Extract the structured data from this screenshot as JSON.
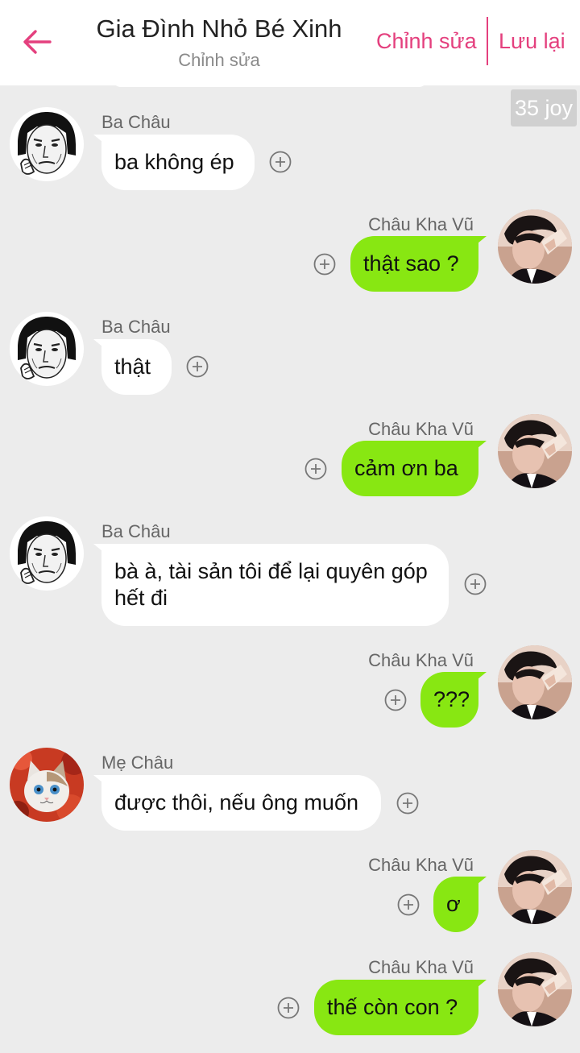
{
  "header": {
    "title": "Gia Đình Nhỏ Bé Xinh",
    "subtitle": "Chỉnh sửa",
    "edit_label": "Chỉnh sửa",
    "save_label": "Lưu lại"
  },
  "badge": "35 joy",
  "messages": [
    {
      "sender": "Ba Châu",
      "text": "ba không ép"
    },
    {
      "sender": "Châu Kha Vũ",
      "text": "thật sao ?"
    },
    {
      "sender": "Ba Châu",
      "text": "thật"
    },
    {
      "sender": "Châu Kha Vũ",
      "text": "cảm ơn ba"
    },
    {
      "sender": "Ba Châu",
      "text": "bà à, tài sản tôi để lại quyên góp hết đi"
    },
    {
      "sender": "Châu Kha Vũ",
      "text": "???"
    },
    {
      "sender": "Mẹ Châu",
      "text": "được thôi, nếu ông muốn"
    },
    {
      "sender": "Châu Kha Vũ",
      "text": "ơ"
    },
    {
      "sender": "Châu Kha Vũ",
      "text": "thế còn con ?"
    }
  ],
  "colors": {
    "accent": "#e4407e",
    "bubble_self": "#88e712",
    "bubble_other": "#ffffff",
    "background": "#ececec"
  }
}
